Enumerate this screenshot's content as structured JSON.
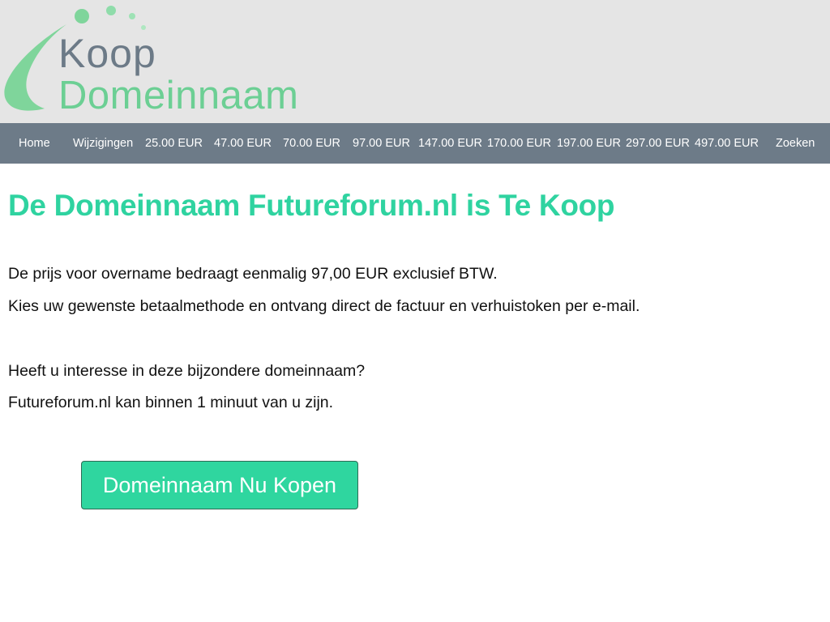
{
  "logo": {
    "line1": "Koop",
    "line2": "Domeinnaam"
  },
  "nav": {
    "items": [
      {
        "label": "Home"
      },
      {
        "label": "Wijzigingen"
      },
      {
        "label": "25.00 EUR"
      },
      {
        "label": "47.00 EUR"
      },
      {
        "label": "70.00 EUR"
      },
      {
        "label": "97.00 EUR"
      },
      {
        "label": "147.00 EUR"
      },
      {
        "label": "170.00 EUR"
      },
      {
        "label": "197.00 EUR"
      },
      {
        "label": "297.00 EUR"
      },
      {
        "label": "497.00 EUR"
      },
      {
        "label": "Zoeken"
      }
    ]
  },
  "main": {
    "title": "De Domeinnaam Futureforum.nl is Te Koop",
    "price_text": "De prijs voor overname bedraagt eenmalig 97,00 EUR exclusief BTW.",
    "payment_text": "Kies uw gewenste betaalmethode en ontvang direct de factuur en verhuistoken per e-mail.",
    "interest_text": "Heeft u interesse in deze bijzondere domeinnaam?",
    "minute_text": "Futureforum.nl kan binnen 1 minuut van u zijn.",
    "buy_button": "Domeinnaam Nu Kopen"
  },
  "colors": {
    "header_bg": "#e5e5e5",
    "nav_bg": "#6d7b88",
    "accent_green": "#2fd3a0",
    "logo_grey": "#6c7a87",
    "logo_green": "#6ccf94"
  }
}
